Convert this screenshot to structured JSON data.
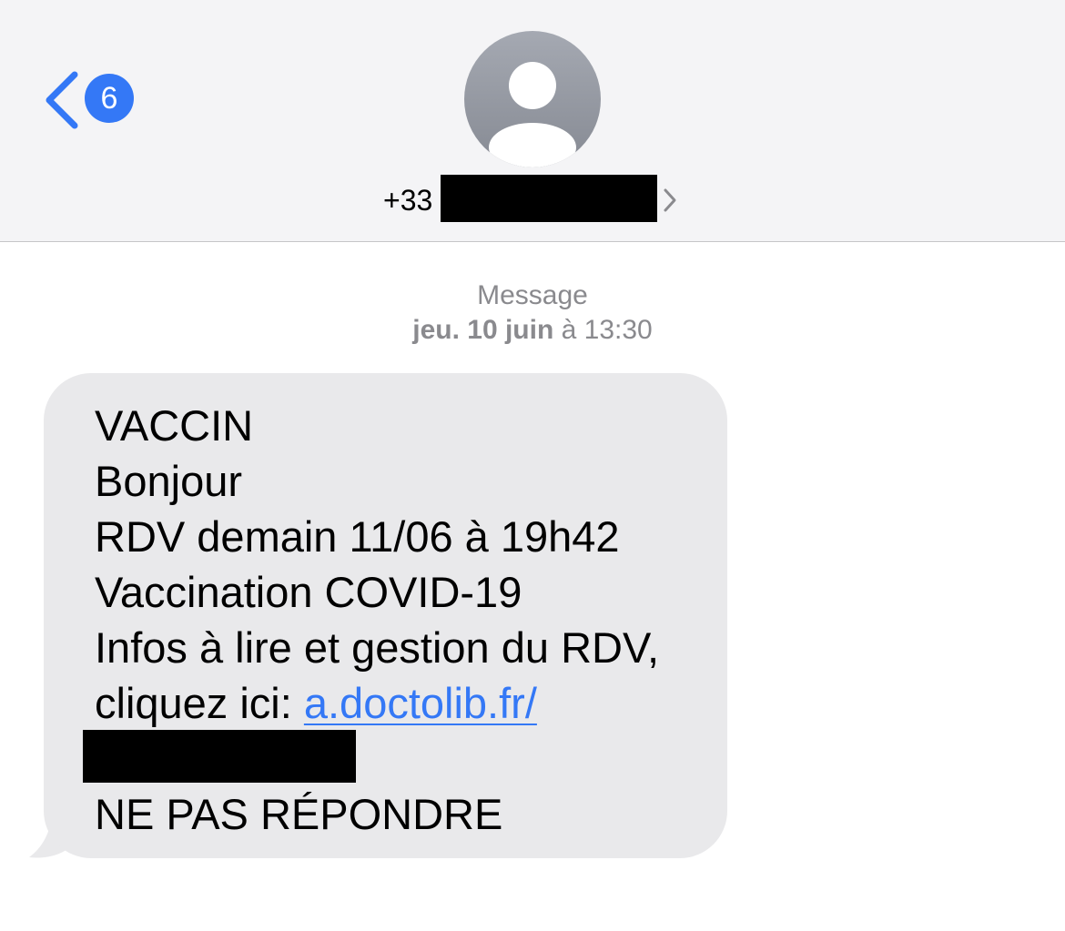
{
  "header": {
    "back_badge_count": "6",
    "contact": {
      "phone_prefix": "+33",
      "phone_redacted": true
    }
  },
  "thread": {
    "service_label": "Message",
    "date_bold": "jeu. 10 juin",
    "date_rest": " à 13:30"
  },
  "message": {
    "line1": "VACCIN",
    "line2": "Bonjour",
    "line3": "RDV demain 11/06 à 19h42",
    "line4": "Vaccination COVID-19",
    "line5": "Infos à lire et gestion du RDV,",
    "line6_prefix": "cliquez ici: ",
    "link_text": "a.doctolib.fr/",
    "line_last": "NE PAS RÉPONDRE"
  },
  "colors": {
    "accent": "#3478f6",
    "header_bg": "#f4f4f6",
    "bubble_bg": "#e9e9eb",
    "meta_text": "#8a8a8e"
  },
  "icons": {
    "back": "chevron-left-icon",
    "avatar": "person-icon",
    "contact_disclosure": "chevron-right-icon"
  }
}
